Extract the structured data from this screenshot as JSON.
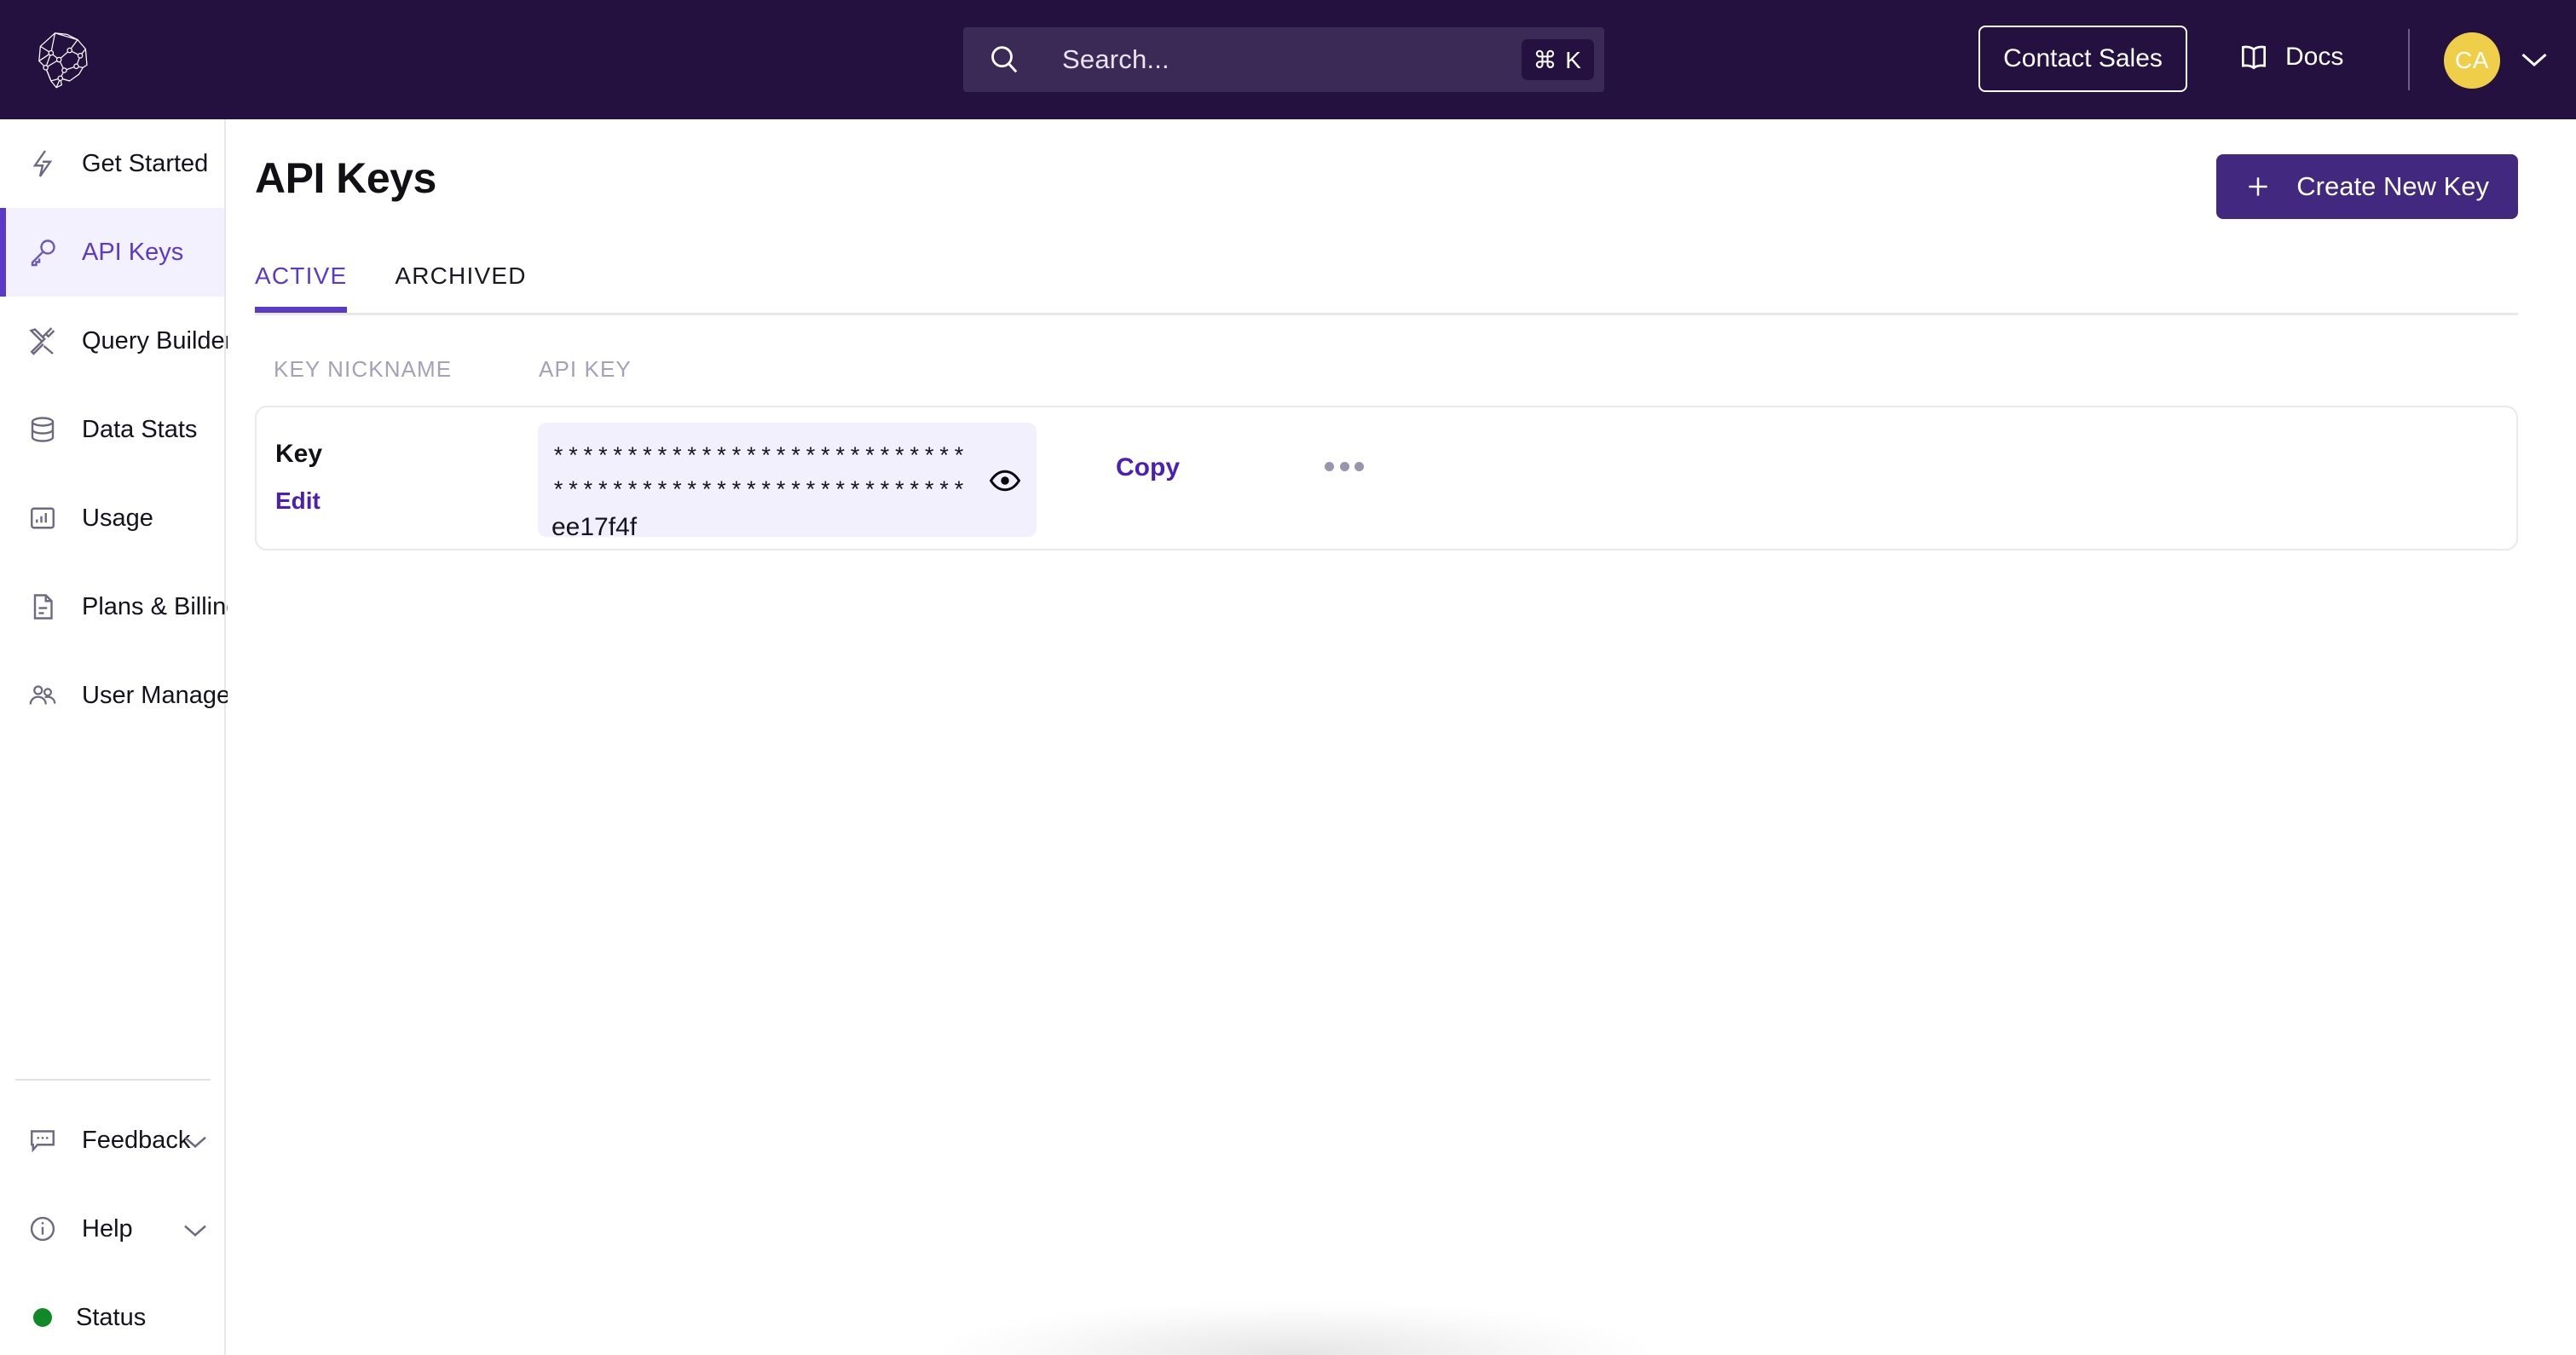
{
  "brand": {
    "logo_icon": "brain-network-logo",
    "header_bg": "#241140",
    "accent_purple": "#5b39c9",
    "button_purple": "#42297f",
    "link_purple": "#4b1fb5",
    "avatar_yellow": "#efce4a",
    "status_green": "#0f8a26"
  },
  "header": {
    "search": {
      "placeholder": "Search...",
      "value": "",
      "shortcut": "⌘ K",
      "icon": "search-icon"
    },
    "contact_sales_label": "Contact Sales",
    "docs_label": "Docs",
    "docs_icon": "book-icon",
    "avatar_initials": "CA",
    "avatar_chevron_icon": "chevron-down-icon"
  },
  "sidebar": {
    "items": [
      {
        "label": "Get Started",
        "icon": "lightning-bolt-icon",
        "active": false
      },
      {
        "label": "API Keys",
        "icon": "key-icon",
        "active": true
      },
      {
        "label": "Query Builder",
        "icon": "tools-icon",
        "active": false
      },
      {
        "label": "Data Stats",
        "icon": "database-icon",
        "active": false
      },
      {
        "label": "Usage",
        "icon": "bar-chart-icon",
        "active": false
      },
      {
        "label": "Plans & Billing",
        "icon": "document-icon",
        "active": false
      },
      {
        "label": "User Management",
        "icon": "users-icon",
        "active": false
      }
    ],
    "bottom_items": [
      {
        "label": "Feedback",
        "icon": "chat-bubble-icon",
        "chevron": "chevron-down-icon"
      },
      {
        "label": "Help",
        "icon": "info-circle-icon",
        "chevron": "chevron-down-icon"
      }
    ],
    "status": {
      "label": "Status",
      "indicator": "green-dot"
    }
  },
  "main": {
    "title": "API Keys",
    "create_button": {
      "label": "Create New Key",
      "icon": "plus-icon"
    },
    "tabs": [
      {
        "label": "ACTIVE",
        "active": true
      },
      {
        "label": "ARCHIVED",
        "active": false
      }
    ],
    "table": {
      "columns": [
        "KEY NICKNAME",
        "API KEY"
      ],
      "rows": [
        {
          "nickname": "Key",
          "edit_label": "Edit",
          "api_key_masked": "********************************************************f",
          "api_key_tail": "ee17f4f",
          "reveal_icon": "eye-icon",
          "copy_label": "Copy",
          "more_icon": "ellipsis-icon"
        }
      ]
    }
  }
}
